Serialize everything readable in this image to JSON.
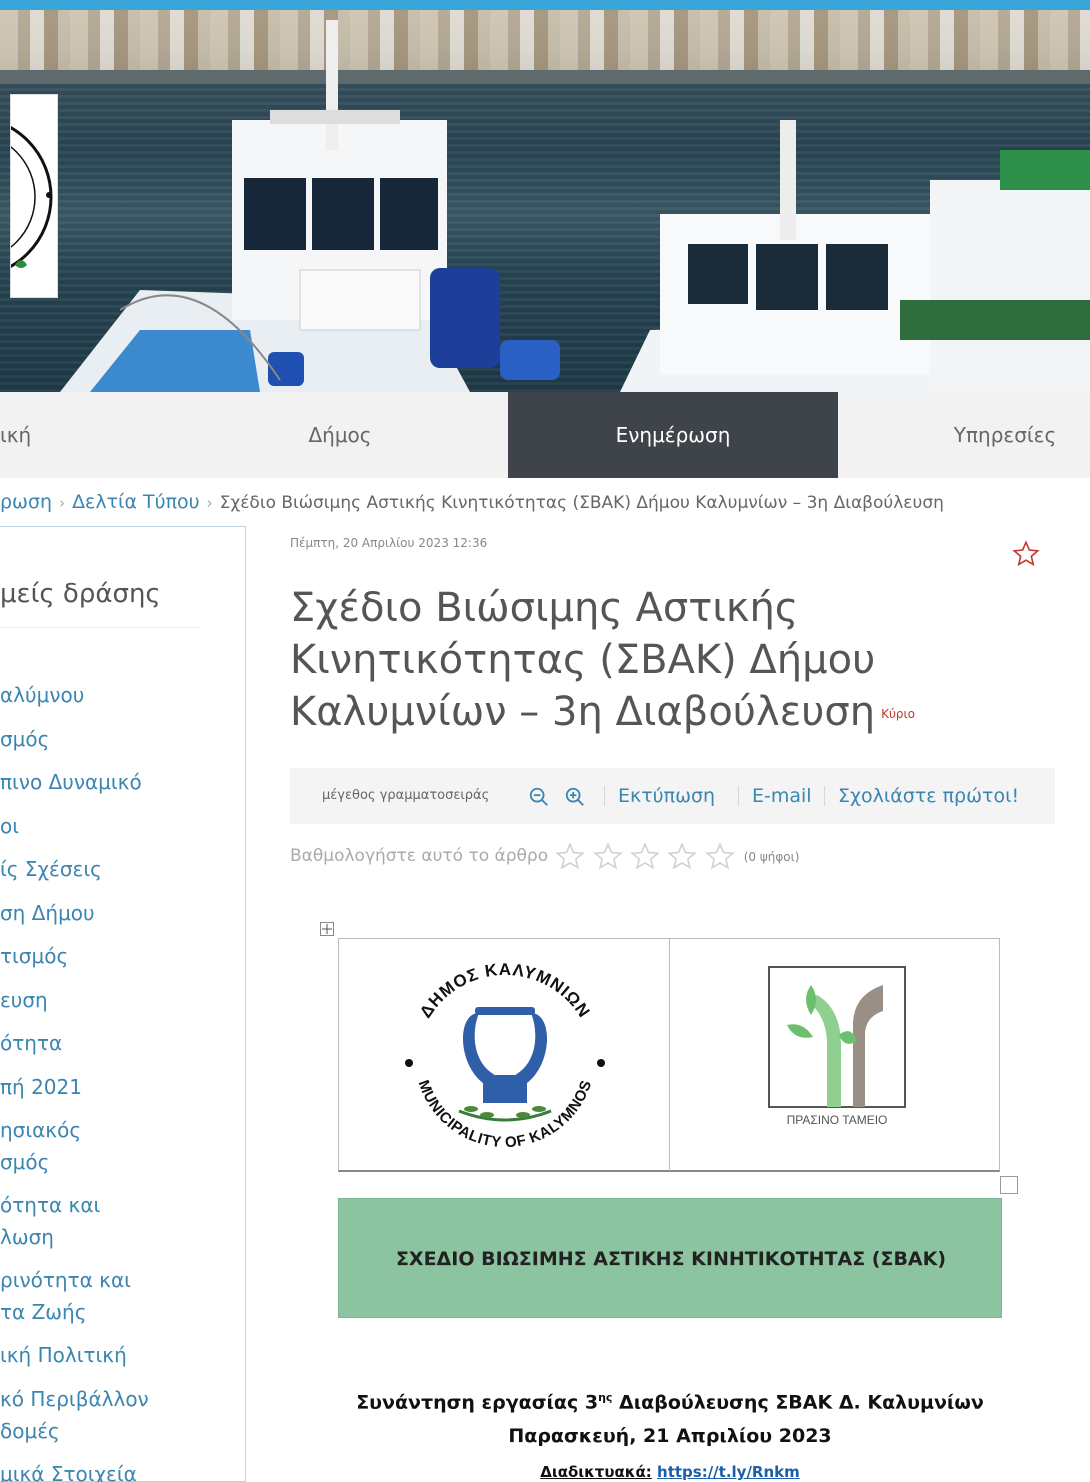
{
  "nav": {
    "items": [
      {
        "label": "ική"
      },
      {
        "label": "Δήμος"
      },
      {
        "label": "Ενημέρωση",
        "active": true
      },
      {
        "label": "Υπηρεσίες"
      }
    ]
  },
  "breadcrumb": {
    "items": [
      "ρωση",
      "Δελτία Τύπου"
    ],
    "current": "Σχέδιο Βιώσιμης Αστικής Κινητικότητας (ΣΒΑΚ) Δήμου Καλυμνίων – 3η Διαβούλευση"
  },
  "sidebar": {
    "title": "μείς δράσης",
    "items": [
      "αλύμνου",
      "σμός",
      "πινο Δυναμικό",
      "οι",
      "ίς Σχέσεις",
      "ση Δήμου",
      "τισμός",
      "ευση",
      "ότητα",
      "πή 2021",
      "ησιακός",
      "σμός",
      "ότητα και",
      "λωση",
      "ρινότητα και",
      "τα Ζωής",
      "ική Πολιτική",
      "κό Περιβάλλον",
      "δομές",
      "μικά Στοιχεία"
    ]
  },
  "article": {
    "date": "Πέμπτη, 20 Απριλίου 2023 12:36",
    "title": "Σχέδιο Βιώσιμης Αστικής Κινητικότητας (ΣΒΑΚ) Δήμου Καλυμνίων – 3η Διαβούλευση",
    "badge": "Κύριο"
  },
  "tools": {
    "font_size_label": "μέγεθος γραμματοσειράς",
    "print_label": "Εκτύπωση",
    "email_label": "E-mail",
    "comment_label": "Σχολιάστε πρώτοι!"
  },
  "rating": {
    "label": "Βαθμολογήστε αυτό το άρθρο",
    "votes": "(0 ψήφοι)",
    "stars": 0,
    "max_stars": 5
  },
  "document": {
    "logo_left_text_top": "ΔΗΜΟΣ ΚΑΛΥΜΝΙΩΝ",
    "logo_left_text_bottom": "MUNICIPALITY OF KALYMNOS",
    "logo_right_caption": "ΠΡΑΣΙΝΟ ΤΑΜΕΙΟ",
    "banner_text": "ΣΧΕΔΙΟ ΒΙΩΣΙΜΗΣ ΑΣΤΙΚΗΣ ΚΙΝΗΤΙΚΟΤΗΤΑΣ (ΣΒΑΚ)",
    "meeting_line1_a": "Συνάντηση εργασίας 3",
    "meeting_line1_sup": "ης",
    "meeting_line1_b": " Διαβούλευσης ΣΒΑΚ Δ. Καλυμνίων",
    "meeting_line2": "Παρασκευή, 21 Απριλίου 2023",
    "meeting_line3_label": "Διαδικτυακά:",
    "meeting_line3_link": "https://t.ly/Rnkm"
  },
  "colors": {
    "accent_link": "#3a86b0",
    "nav_active_bg": "#3e4449",
    "banner_green": "#8cc4a2",
    "badge_red": "#c0392b"
  }
}
